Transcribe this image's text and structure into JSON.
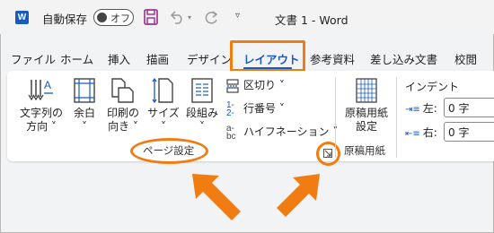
{
  "titlebar": {
    "app_icon": "word-icon",
    "app_letter": "W",
    "autosave_label": "自動保存",
    "autosave_state": "オフ",
    "doc_title": "文書 1 - Word",
    "qat_more": "▿"
  },
  "tabs": [
    {
      "label": "ファイル"
    },
    {
      "label": "ホーム"
    },
    {
      "label": "挿入"
    },
    {
      "label": "描画"
    },
    {
      "label": "デザイン"
    },
    {
      "label": "レイアウト",
      "active": true
    },
    {
      "label": "参考資料"
    },
    {
      "label": "差し込み文書"
    },
    {
      "label": "校閲"
    }
  ],
  "ribbon": {
    "page_setup": {
      "text_direction": {
        "line1": "文字列の",
        "line2": "方向 ˅"
      },
      "margins": {
        "line1": "余白",
        "line2": "˅"
      },
      "orientation": {
        "line1": "印刷の",
        "line2": "向き ˅"
      },
      "size": {
        "line1": "サイズ",
        "line2": "˅"
      },
      "columns": {
        "line1": "段組み",
        "line2": "˅"
      },
      "breaks": "区切り ˅",
      "line_numbers": "行番号 ˅",
      "hyphenation": "ハイフネーション ˅",
      "group_label": "ページ設定"
    },
    "manuscript": {
      "button": {
        "line1": "原稿用紙",
        "line2": "設定"
      },
      "group_label": "原稿用紙"
    },
    "indent": {
      "title": "インデント",
      "left_label": "左:",
      "left_value": "0 字",
      "right_label": "右:",
      "right_value": "0 字"
    }
  },
  "colors": {
    "accent": "#185abd",
    "highlight": "#f07c12",
    "save_icon": "#9b2a8e"
  }
}
